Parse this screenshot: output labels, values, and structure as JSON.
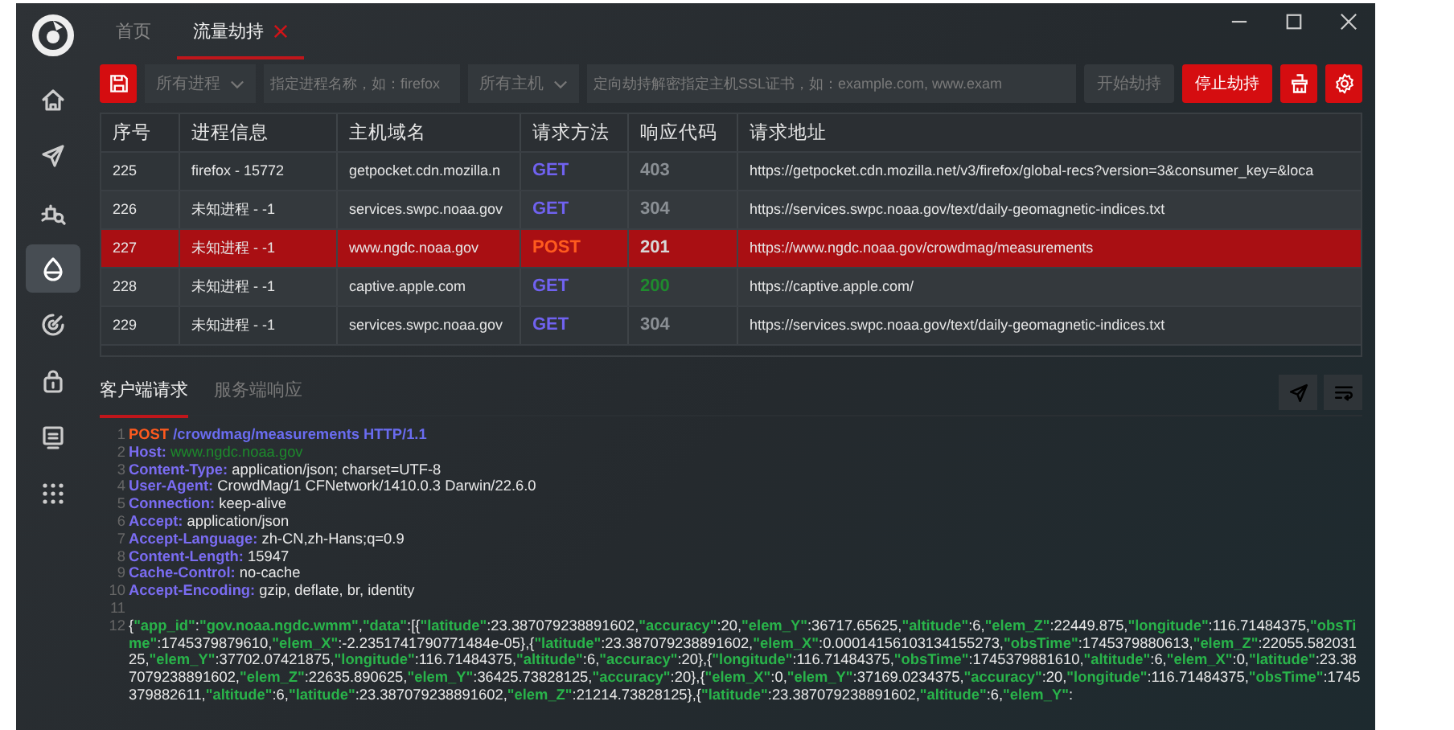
{
  "sidebar": {
    "items": [
      {
        "kind": "home",
        "selected": false
      },
      {
        "kind": "send",
        "selected": false
      },
      {
        "kind": "bug",
        "selected": false
      },
      {
        "kind": "drop",
        "selected": true
      },
      {
        "kind": "target",
        "selected": false
      },
      {
        "kind": "lock",
        "selected": false
      },
      {
        "kind": "monitor",
        "selected": false
      },
      {
        "kind": "grid",
        "selected": false
      }
    ]
  },
  "tabs": [
    {
      "label": "首页",
      "selected": false,
      "closable": false
    },
    {
      "label": "流量劫持",
      "selected": true,
      "closable": true
    }
  ],
  "toolbar": {
    "process_filter": "所有进程",
    "process_placeholder": "指定进程名称，如：firefox",
    "host_filter": "所有主机",
    "host_placeholder": "定向劫持解密指定主机SSL证书，如：example.com, www.exam",
    "start_button": {
      "label": "开始劫持",
      "disabled": true
    },
    "stop_button": {
      "label": "停止劫持",
      "disabled": false
    }
  },
  "table": {
    "columns": [
      "序号",
      "进程信息",
      "主机域名",
      "请求方法",
      "响应代码",
      "请求地址"
    ],
    "rows": [
      {
        "seq": "225",
        "process": "firefox - 15772",
        "host": "getpocket.cdn.mozilla.n",
        "method": {
          "text": "GET",
          "color": "#7062f0"
        },
        "code": {
          "text": "403",
          "color": "#8a8f94"
        },
        "url": "https://getpocket.cdn.mozilla.net/v3/firefox/global-recs?version=3&consumer_key=&loca",
        "selected": false
      },
      {
        "seq": "226",
        "process": "未知进程 - -1",
        "host": "services.swpc.noaa.gov",
        "method": {
          "text": "GET",
          "color": "#7062f0"
        },
        "code": {
          "text": "304",
          "color": "#8a8f94"
        },
        "url": "https://services.swpc.noaa.gov/text/daily-geomagnetic-indices.txt",
        "selected": false
      },
      {
        "seq": "227",
        "process": "未知进程 - -1",
        "host": "www.ngdc.noaa.gov",
        "method": {
          "text": "POST",
          "color": "#ff5a1e"
        },
        "code": {
          "text": "201",
          "color": "#d8d8d8"
        },
        "url": "https://www.ngdc.noaa.gov/crowdmag/measurements",
        "selected": true
      },
      {
        "seq": "228",
        "process": "未知进程 - -1",
        "host": "captive.apple.com",
        "method": {
          "text": "GET",
          "color": "#7062f0"
        },
        "code": {
          "text": "200",
          "color": "#1f8a2e"
        },
        "url": "https://captive.apple.com/",
        "selected": false
      },
      {
        "seq": "229",
        "process": "未知进程 - -1",
        "host": "services.swpc.noaa.gov",
        "method": {
          "text": "GET",
          "color": "#7062f0"
        },
        "code": {
          "text": "304",
          "color": "#8a8f94"
        },
        "url": "https://services.swpc.noaa.gov/text/daily-geomagnetic-indices.txt",
        "selected": false
      }
    ]
  },
  "detail_tabs": [
    {
      "label": "客户端请求",
      "selected": true
    },
    {
      "label": "服务端响应",
      "selected": false
    }
  ],
  "code_lines": [
    {
      "number": "1",
      "kind": "request_line",
      "method": "POST",
      "path": "/crowdmag/measurements HTTP/1.1"
    },
    {
      "number": "2",
      "kind": "host_header",
      "name": "Host:",
      "value": "www.ngdc.noaa.gov"
    },
    {
      "number": "3",
      "kind": "header",
      "name": "Content-Type:",
      "value": "application/json; charset=UTF-8"
    },
    {
      "number": "4",
      "kind": "header",
      "name": "User-Agent:",
      "value": "CrowdMag/1 CFNetwork/1410.0.3 Darwin/22.6.0"
    },
    {
      "number": "5",
      "kind": "header",
      "name": "Connection:",
      "value": "keep-alive"
    },
    {
      "number": "6",
      "kind": "header",
      "name": "Accept:",
      "value": "application/json"
    },
    {
      "number": "7",
      "kind": "header",
      "name": "Accept-Language:",
      "value": "zh-CN,zh-Hans;q=0.9"
    },
    {
      "number": "8",
      "kind": "header",
      "name": "Content-Length:",
      "value": "15947"
    },
    {
      "number": "9",
      "kind": "header",
      "name": "Cache-Control:",
      "value": "no-cache"
    },
    {
      "number": "10",
      "kind": "header",
      "name": "Accept-Encoding:",
      "value": "gzip, deflate, br, identity"
    },
    {
      "number": "11",
      "kind": "blank"
    },
    {
      "number": "12",
      "kind": "body",
      "text": "{\"app_id\":\"gov.noaa.ngdc.wmm\",\"data\":[{\"latitude\":23.387079238891602,\"accuracy\":20,\"elem_Y\":36717.65625,\"altitude\":6,\"elem_Z\":22449.875,\"longitude\":116.71484375,\"obsTime\":1745379879610,\"elem_X\":-2.2351741790771484e-05},{\"latitude\":23.387079238891602,\"elem_X\":0.00014156103134155273,\"obsTime\":1745379880613,\"elem_Z\":22055.58203125,\"elem_Y\":37702.07421875,\"longitude\":116.71484375,\"altitude\":6,\"accuracy\":20},{\"longitude\":116.71484375,\"obsTime\":1745379881610,\"altitude\":6,\"elem_X\":0,\"latitude\":23.387079238891602,\"elem_Z\":22635.890625,\"elem_Y\":36425.73828125,\"accuracy\":20},{\"elem_X\":0,\"elem_Y\":37169.0234375,\"accuracy\":20,\"longitude\":116.71484375,\"obsTime\":1745379882611,\"altitude\":6,\"latitude\":23.387079238891602,\"elem_Z\":21214.73828125},{\"latitude\":23.387079238891602,\"altitude\":6,\"elem_Y\":"
    }
  ]
}
